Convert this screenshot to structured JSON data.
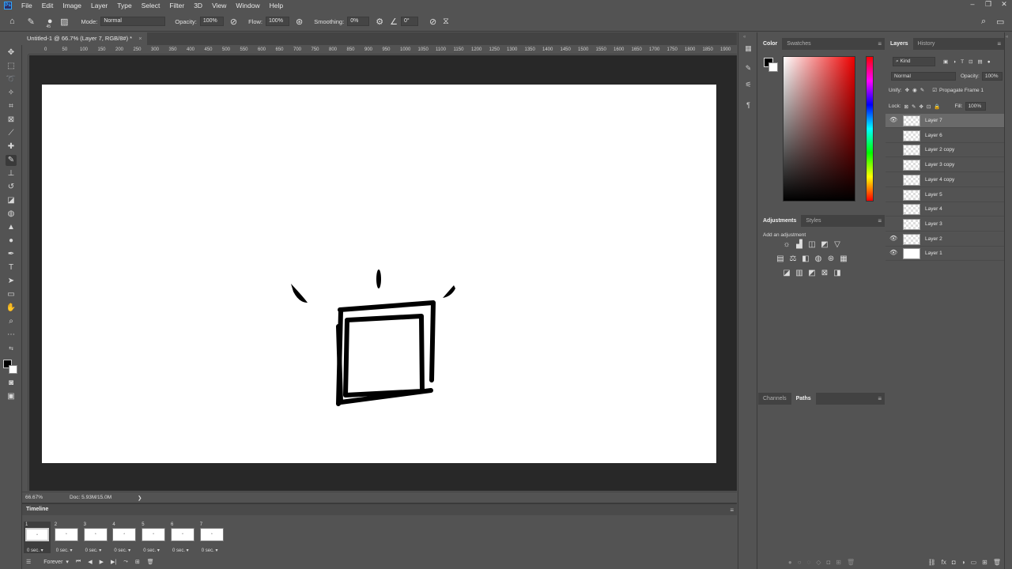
{
  "app": {
    "logo": "Ps"
  },
  "menu": [
    "File",
    "Edit",
    "Image",
    "Layer",
    "Type",
    "Select",
    "Filter",
    "3D",
    "View",
    "Window",
    "Help"
  ],
  "options": {
    "brush_size": "45",
    "mode_label": "Mode:",
    "mode_value": "Normal",
    "opacity_label": "Opacity:",
    "opacity_value": "100%",
    "flow_label": "Flow:",
    "flow_value": "100%",
    "smoothing_label": "Smoothing:",
    "smoothing_value": "0%",
    "angle_value": "0°"
  },
  "document": {
    "tab_title": "Untitled-1 @ 66.7% (Layer 7, RGB/8#) *",
    "close": "×"
  },
  "ruler": {
    "h_ticks": [
      "0",
      "50",
      "100",
      "150",
      "200",
      "250",
      "300",
      "350",
      "400",
      "450",
      "500",
      "550",
      "600",
      "650",
      "700",
      "750",
      "800",
      "850",
      "900",
      "950",
      "1000",
      "1050",
      "1100",
      "1150",
      "1200",
      "1250",
      "1300",
      "1350",
      "1400",
      "1450",
      "1500",
      "1550",
      "1600",
      "1650",
      "1700",
      "1750",
      "1800",
      "1850",
      "1900"
    ]
  },
  "status": {
    "zoom": "66.67%",
    "doc": "Doc: 5.93M/15.0M",
    "arrow": "❯"
  },
  "timeline": {
    "title": "Timeline",
    "frames": [
      {
        "num": "1",
        "delay": "0 sec.",
        "selected": true
      },
      {
        "num": "2",
        "delay": "0 sec.",
        "selected": false
      },
      {
        "num": "3",
        "delay": "0 sec.",
        "selected": false
      },
      {
        "num": "4",
        "delay": "0 sec.",
        "selected": false
      },
      {
        "num": "5",
        "delay": "0 sec.",
        "selected": false
      },
      {
        "num": "6",
        "delay": "0 sec.",
        "selected": false
      },
      {
        "num": "7",
        "delay": "0 sec.",
        "selected": false
      }
    ],
    "loop": "Forever"
  },
  "color_panel": {
    "tabs": [
      "Color",
      "Swatches"
    ],
    "fg": "#000000",
    "bg": "#ffffff"
  },
  "adjustments_panel": {
    "tabs": [
      "Adjustments",
      "Styles"
    ],
    "hint": "Add an adjustment"
  },
  "channels_panel": {
    "tabs": [
      "Channels",
      "Paths"
    ]
  },
  "layers_panel": {
    "tabs": [
      "Layers",
      "History"
    ],
    "kind": "Kind",
    "blend": "Normal",
    "opacity_label": "Opacity:",
    "opacity_value": "100%",
    "unify_label": "Unify:",
    "propagate": "Propagate Frame 1",
    "lock_label": "Lock:",
    "fill_label": "Fill:",
    "fill_value": "100%",
    "layers": [
      {
        "name": "Layer 7",
        "visible": true,
        "selected": true
      },
      {
        "name": "Layer 6",
        "visible": false,
        "selected": false
      },
      {
        "name": "Layer 2 copy",
        "visible": false,
        "selected": false
      },
      {
        "name": "Layer 3 copy",
        "visible": false,
        "selected": false
      },
      {
        "name": "Layer 4 copy",
        "visible": false,
        "selected": false
      },
      {
        "name": "Layer 5",
        "visible": false,
        "selected": false
      },
      {
        "name": "Layer 4",
        "visible": false,
        "selected": false
      },
      {
        "name": "Layer 3",
        "visible": false,
        "selected": false
      },
      {
        "name": "Layer 2",
        "visible": true,
        "selected": false
      },
      {
        "name": "Layer 1",
        "visible": true,
        "selected": false
      }
    ]
  }
}
